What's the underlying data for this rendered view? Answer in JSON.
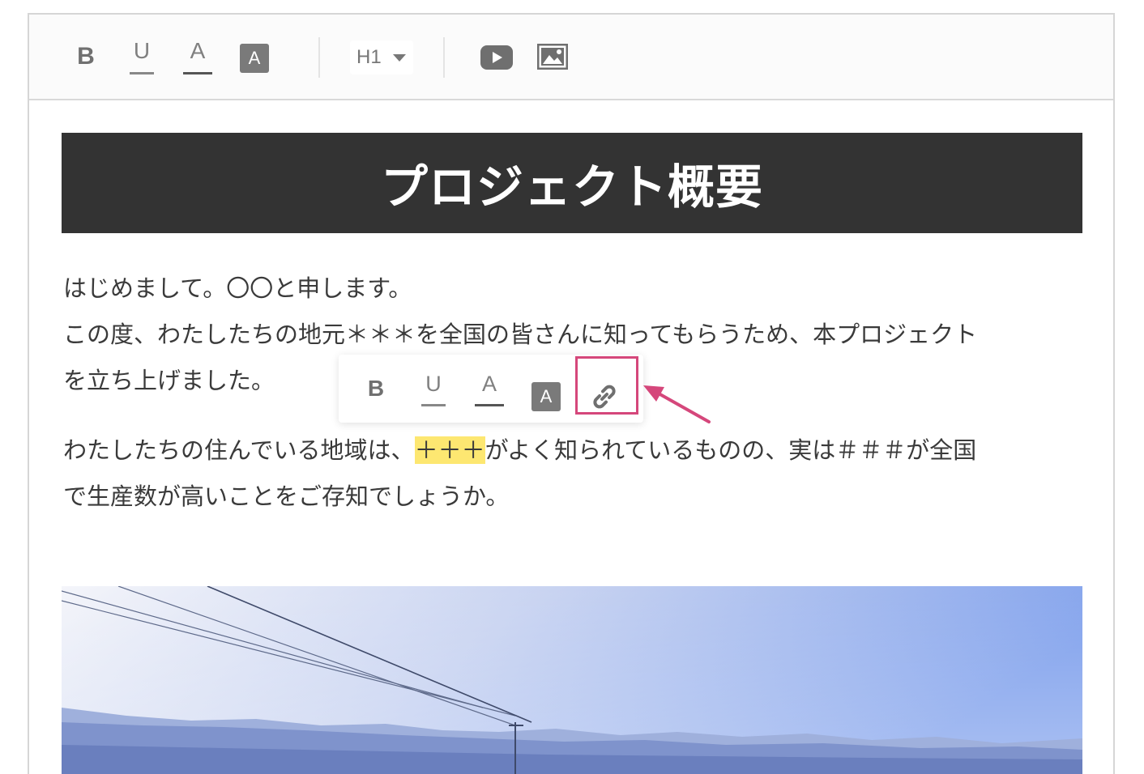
{
  "toolbar": {
    "bold": "B",
    "underline": "U",
    "text_color": "A",
    "bg_color": "A",
    "heading_select": "H1",
    "icons": [
      "youtube-icon",
      "image-icon"
    ]
  },
  "floating_toolbar": {
    "bold": "B",
    "underline": "U",
    "text_color": "A",
    "bg_color": "A",
    "icons": [
      "link-icon"
    ],
    "highlight_color": "#d5477b"
  },
  "content": {
    "heading": "プロジェクト概要",
    "para1_line1": "はじめまして。〇〇と申します。",
    "para1_line2": "この度、わたしたちの地元＊＊＊を全国の皆さんに知ってもらうため、本プロジェクト",
    "para1_line3": "を立ち上げました。",
    "para2_line1_before": "わたしたちの住んでいる地域は、",
    "para2_line1_highlight": "＋＋＋",
    "para2_line1_after": "がよく知られているものの、実は＃＃＃が全国",
    "para2_line2": "で生産数が高いことをご存知でしょうか。"
  },
  "colors": {
    "heading_bg": "#333333",
    "highlight": "#fde771",
    "text_color_underline": "#555555",
    "underline_underline": "#888888"
  }
}
